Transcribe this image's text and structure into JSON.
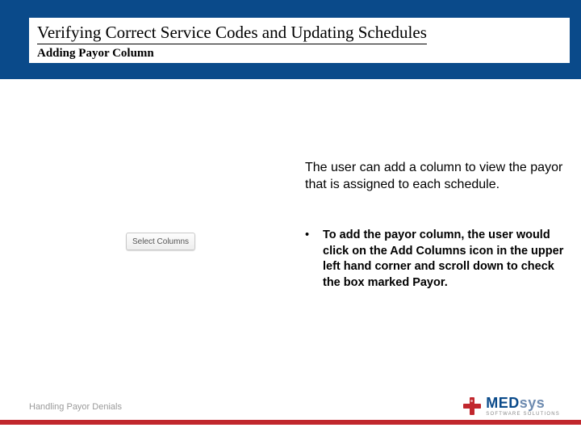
{
  "header": {
    "title": "Verifying Correct Service Codes and Updating Schedules",
    "subtitle": "Adding Payor Column"
  },
  "button": {
    "label": "Select Columns"
  },
  "body": {
    "intro": "The user can add a column to view the payor that is assigned to each schedule.",
    "bullets": [
      "To add the payor column, the user would click on the Add Columns icon in the upper left hand corner and scroll down to check the box marked Payor."
    ]
  },
  "footer": {
    "text": "Handling Payor Denials",
    "logo_main_a": "MED",
    "logo_main_b": "sys",
    "logo_tag": "SOFTWARE SOLUTIONS"
  }
}
